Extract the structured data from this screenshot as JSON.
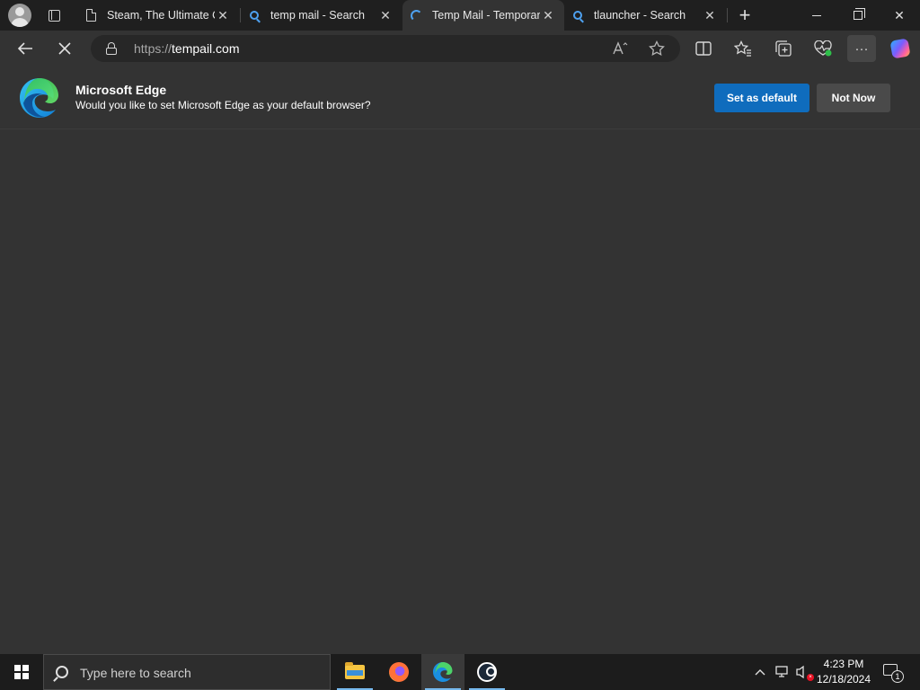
{
  "tabs": [
    {
      "label": "Steam, The Ultimate O",
      "icon": "page-icon",
      "active": false
    },
    {
      "label": "temp mail - Search",
      "icon": "search-icon",
      "active": false
    },
    {
      "label": "Temp Mail - Temporar",
      "icon": "loading-spinner-icon",
      "active": true
    },
    {
      "label": "tlauncher - Search",
      "icon": "search-icon",
      "active": false
    }
  ],
  "tab_close_glyph": "✕",
  "address_bar": {
    "protocol": "https://",
    "domain": "tempail.com"
  },
  "banner": {
    "title": "Microsoft Edge",
    "message": "Would you like to set Microsoft Edge as your default browser?",
    "primary_button": "Set as default",
    "secondary_button": "Not Now"
  },
  "taskbar": {
    "search_placeholder": "Type here to search",
    "apps": [
      "file-explorer",
      "firefox",
      "microsoft-edge",
      "steam"
    ],
    "active_app": "microsoft-edge",
    "time": "4:23 PM",
    "date": "12/18/2024",
    "notification_count": "1"
  },
  "colors": {
    "accent": "#0f6cbd",
    "tab_strip": "#1f1f1f",
    "page_bg": "#333333",
    "taskbar": "#1c1c1c"
  }
}
